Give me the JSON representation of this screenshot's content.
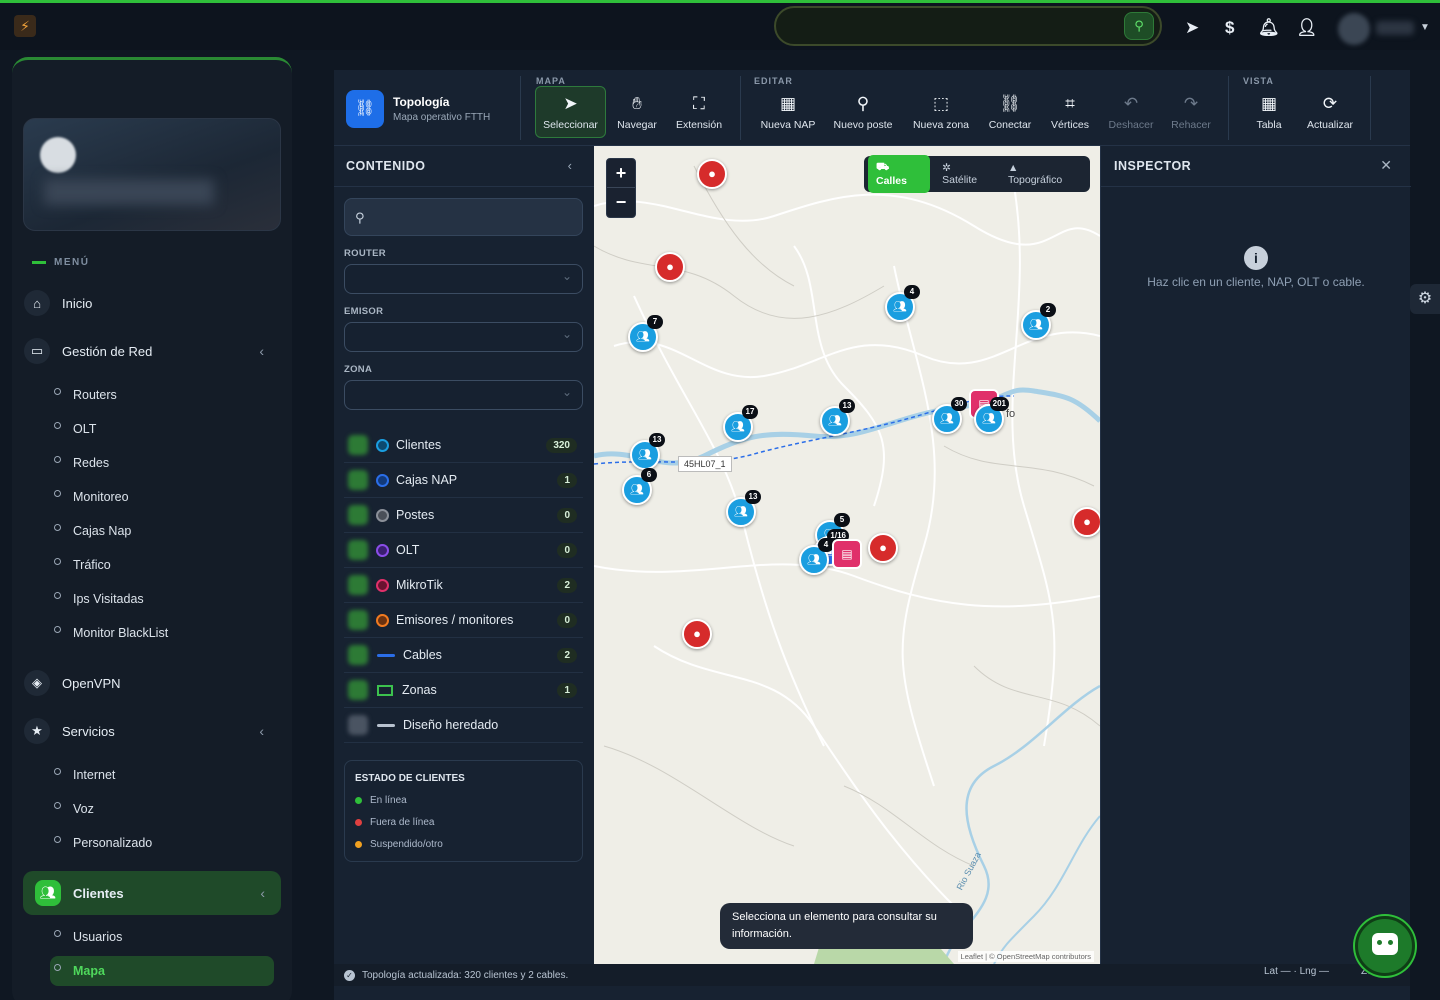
{
  "colors": {
    "accent": "#2fbf3a",
    "online": "#2fbf3a",
    "offline": "#e04040",
    "suspended": "#f0a020",
    "clientes": "#1a9ee0",
    "nap": "#2b6ee8",
    "postes": "#8a8f98",
    "olt": "#8a4de8",
    "mikrotik": "#e0306a",
    "emisores": "#f07a20",
    "cables": "#2b6ee8",
    "zonas": "#3cc24e"
  },
  "sidebar": {
    "menu_label": "MENÚ",
    "items": [
      {
        "label": "Inicio",
        "icon": "home-icon"
      },
      {
        "label": "Gestión de Red",
        "icon": "laptop-icon"
      },
      {
        "label": "OpenVPN",
        "icon": "shield-icon"
      },
      {
        "label": "Servicios",
        "icon": "star-icon"
      },
      {
        "label": "Clientes",
        "icon": "users-icon"
      }
    ],
    "red_sub": [
      "Routers",
      "OLT",
      "Redes",
      "Monitoreo",
      "Cajas Nap",
      "Tráfico",
      "Ips Visitadas",
      "Monitor BlackList"
    ],
    "serv_sub": [
      "Internet",
      "Voz",
      "Personalizado"
    ],
    "cli_sub": [
      "Usuarios",
      "Mapa"
    ]
  },
  "toolbar": {
    "title": "Topología",
    "subtitle": "Mapa operativo FTTH",
    "group_mapa": "MAPA",
    "group_editar": "EDITAR",
    "group_vista": "VISTA",
    "btn": {
      "seleccionar": "Seleccionar",
      "navegar": "Navegar",
      "extension": "Extensión",
      "nueva_nap": "Nueva NAP",
      "nuevo_poste": "Nuevo poste",
      "nueva_zona": "Nueva zona",
      "conectar": "Conectar",
      "vertices": "Vértices",
      "deshacer": "Deshacer",
      "rehacer": "Rehacer",
      "tabla": "Tabla",
      "actualizar": "Actualizar"
    }
  },
  "content": {
    "title": "CONTENIDO",
    "search_placeholder": "",
    "router_label": "ROUTER",
    "emisor_label": "EMISOR",
    "zona_label": "ZONA",
    "layers": [
      {
        "label": "Clientes",
        "count": "320"
      },
      {
        "label": "Cajas NAP",
        "count": "1"
      },
      {
        "label": "Postes",
        "count": "0"
      },
      {
        "label": "OLT",
        "count": "0"
      },
      {
        "label": "MikroTik",
        "count": "2"
      },
      {
        "label": "Emisores / monitores",
        "count": "0"
      },
      {
        "label": "Cables",
        "count": "2"
      },
      {
        "label": "Zonas",
        "count": "1"
      },
      {
        "label": "Diseño heredado",
        "count": ""
      }
    ],
    "estado_title": "ESTADO DE CLIENTES",
    "estado": [
      "En línea",
      "Fuera de línea",
      "Suspendido/otro"
    ]
  },
  "map": {
    "basemaps": [
      "Calles",
      "Satélite",
      "Topográfico"
    ],
    "zoom_in": "+",
    "zoom_out": "−",
    "cable_label": "45HL07_1",
    "river_label": "Rio Suaza",
    "place_fragment": "fo",
    "tooltip": "Selecciona un elemento para consultar su información.",
    "attribution": "Leaflet | © OpenStreetMap contributors",
    "clusters": [
      "7",
      "4",
      "2",
      "17",
      "13",
      "30",
      "201",
      "13",
      "6",
      "13",
      "5",
      "1/16",
      "4"
    ]
  },
  "inspector": {
    "title": "INSPECTOR",
    "message": "Haz clic en un cliente, NAP, OLT o cable."
  },
  "status": {
    "text": "Topología actualizada: 320 clientes y 2 cables.",
    "latlng": "Lat — · Lng —",
    "zoom": "Zo"
  }
}
